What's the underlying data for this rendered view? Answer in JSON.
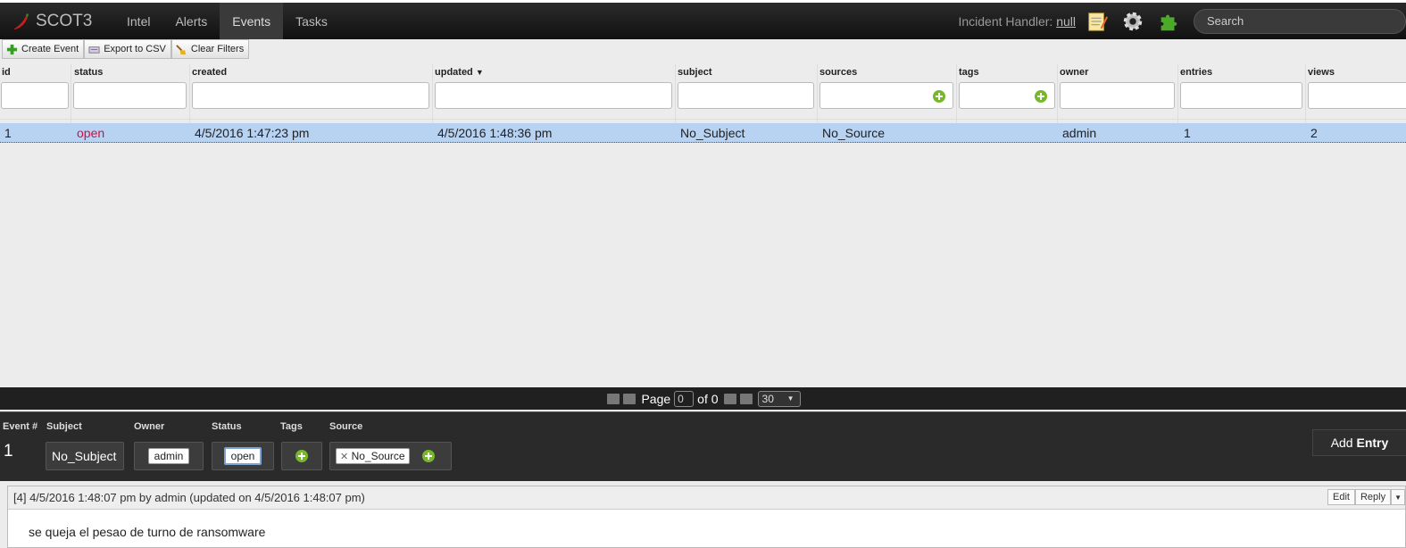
{
  "topbar": {
    "brand": "SCOT3",
    "nav": [
      {
        "label": "Intel",
        "active": false
      },
      {
        "label": "Alerts",
        "active": false
      },
      {
        "label": "Events",
        "active": true
      },
      {
        "label": "Tasks",
        "active": false
      }
    ],
    "handler_label": "Incident Handler:",
    "handler_value": "null",
    "search_placeholder": "Search"
  },
  "toolbar": {
    "create": "Create Event",
    "export": "Export to CSV",
    "clear": "Clear Filters"
  },
  "grid": {
    "columns": [
      "id",
      "status",
      "created",
      "updated",
      "subject",
      "sources",
      "tags",
      "owner",
      "entries",
      "views"
    ],
    "rows": [
      {
        "id": "1",
        "status": "open",
        "created": "4/5/2016 1:47:23 pm",
        "updated": "4/5/2016 1:48:36 pm",
        "subject": "No_Subject",
        "sources": "No_Source",
        "tags": "",
        "owner": "admin",
        "entries": "1",
        "views": "2"
      }
    ]
  },
  "pager": {
    "page_label": "Page",
    "page_value": "0",
    "of_label": "of 0",
    "per_page": "30"
  },
  "detail": {
    "labels": {
      "event": "Event #",
      "subject": "Subject",
      "owner": "Owner",
      "status": "Status",
      "tags": "Tags",
      "source": "Source"
    },
    "event_number": "1",
    "subject": "No_Subject",
    "owner": "admin",
    "status": "open",
    "source": "No_Source",
    "add_entry_1": "Add",
    "add_entry_2": "Entry"
  },
  "entry": {
    "header": "[4] 4/5/2016 1:48:07 pm by admin (updated on 4/5/2016 1:48:07 pm)",
    "edit": "Edit",
    "reply": "Reply",
    "body": "se queja el pesao de turno de ransomware"
  },
  "colors": {
    "open_status": "#d01040",
    "selected_row": "#b8d2f2",
    "accent_green": "#77b82a"
  }
}
